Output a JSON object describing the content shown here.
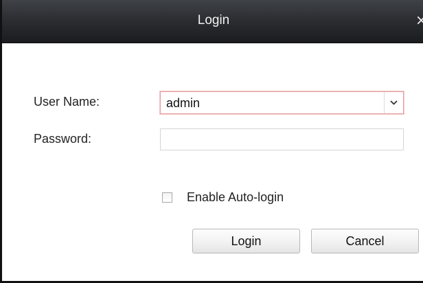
{
  "window": {
    "title": "Login",
    "close_glyph": "×",
    "close_icon": "close-icon"
  },
  "form": {
    "username_label": "User Name:",
    "username_value": "admin",
    "dropdown_icon": "chevron-down-icon",
    "password_label": "Password:",
    "password_value": "",
    "auto_login_label": "Enable Auto-login",
    "auto_login_checked": false
  },
  "buttons": {
    "login_label": "Login",
    "cancel_label": "Cancel"
  },
  "colors": {
    "titlebar": "#2c2e32",
    "focus_border": "#e89ea0"
  }
}
